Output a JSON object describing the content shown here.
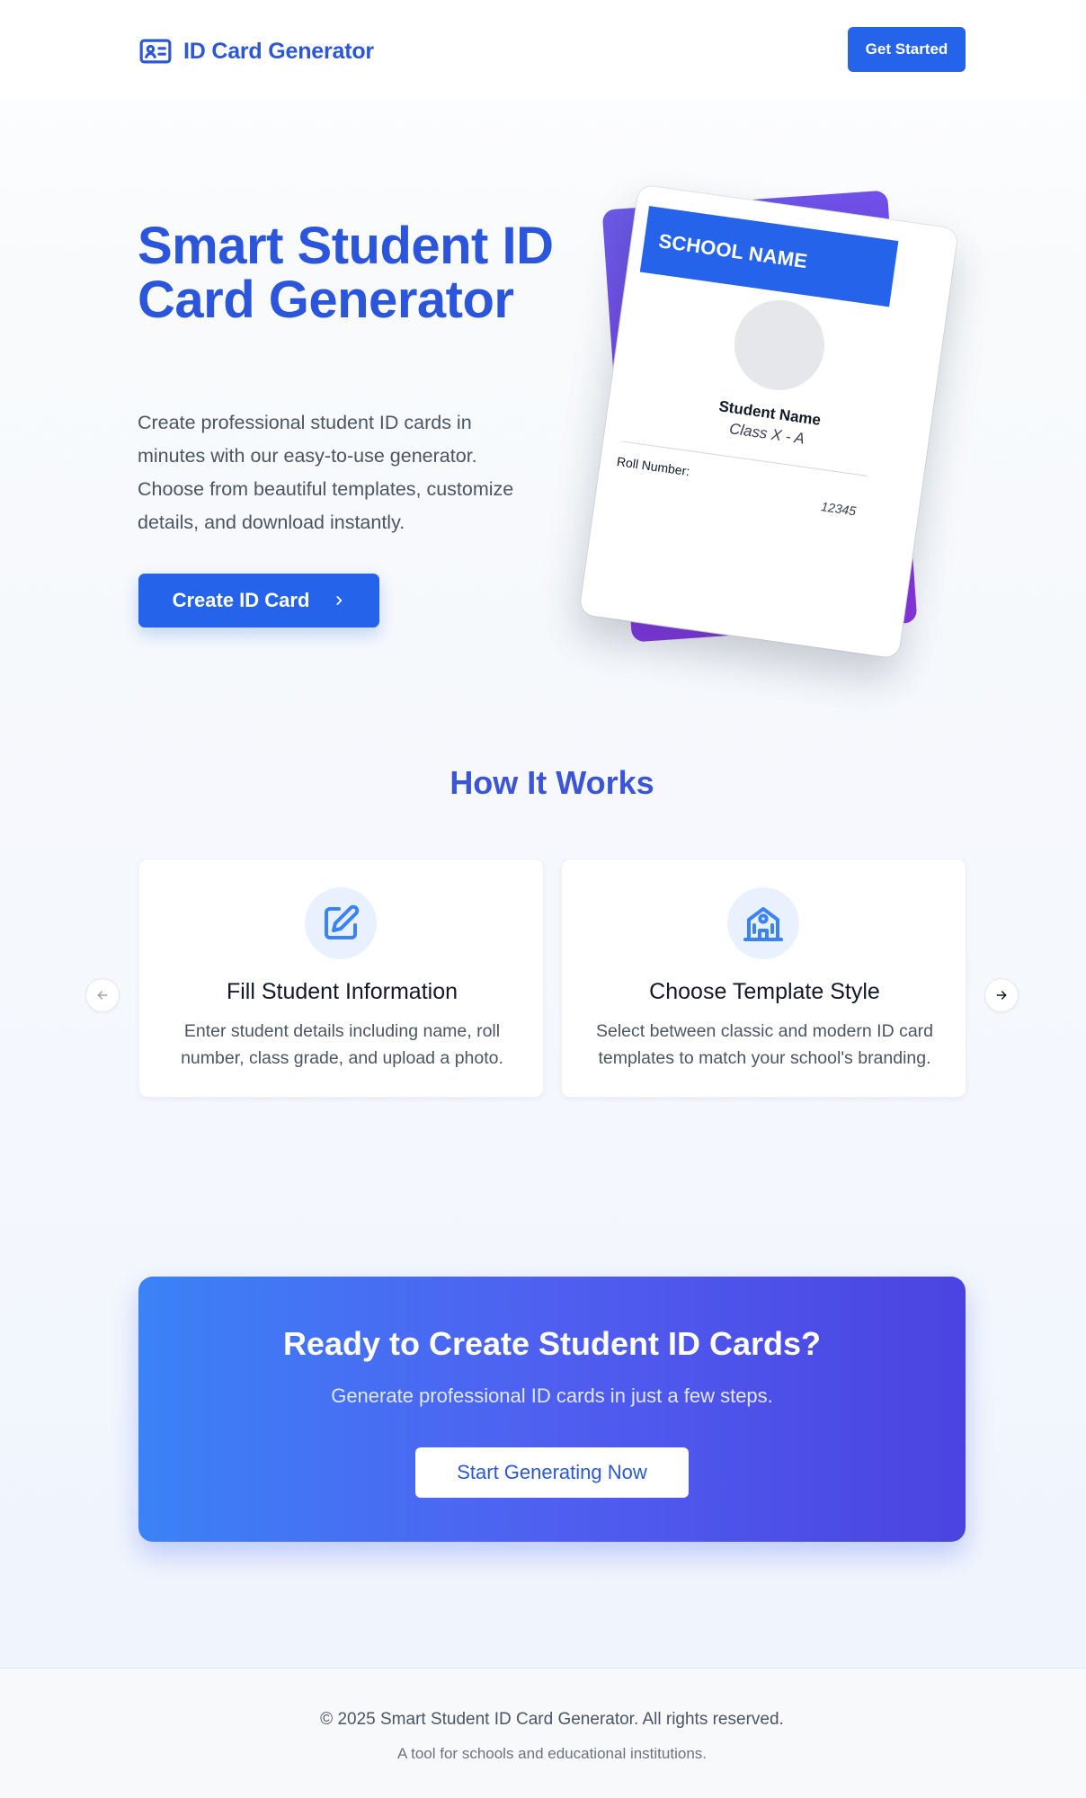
{
  "header": {
    "brand_name": "ID Card Generator",
    "get_started_label": "Get Started"
  },
  "hero": {
    "title": "Smart Student ID Card Generator",
    "description": "Create professional student ID cards in minutes with our easy-to-use generator. Choose from beautiful templates, customize details, and download instantly.",
    "create_button_label": "Create ID Card"
  },
  "id_card_preview": {
    "school_name": "SCHOOL NAME",
    "student_name": "Student Name",
    "class": "Class X - A",
    "roll_label": "Roll Number:",
    "roll_value": "12345"
  },
  "how_it_works": {
    "title": "How It Works",
    "steps": [
      {
        "icon": "edit-icon",
        "title": "Fill Student Information",
        "description": "Enter student details including name, roll number, class grade, and upload a photo."
      },
      {
        "icon": "school-icon",
        "title": "Choose Template Style",
        "description": "Select between classic and modern ID card templates to match your school's branding."
      }
    ]
  },
  "cta": {
    "title": "Ready to Create Student ID Cards?",
    "subtitle": "Generate professional ID cards in just a few steps.",
    "button_label": "Start Generating Now"
  },
  "footer": {
    "copyright": "© 2025 Smart Student ID Card Generator. All rights reserved.",
    "tagline": "A tool for schools and educational institutions."
  },
  "colors": {
    "primary": "#2563eb",
    "heading_blue": "#2b56dc",
    "card_back_purple": "#7c3aed"
  }
}
